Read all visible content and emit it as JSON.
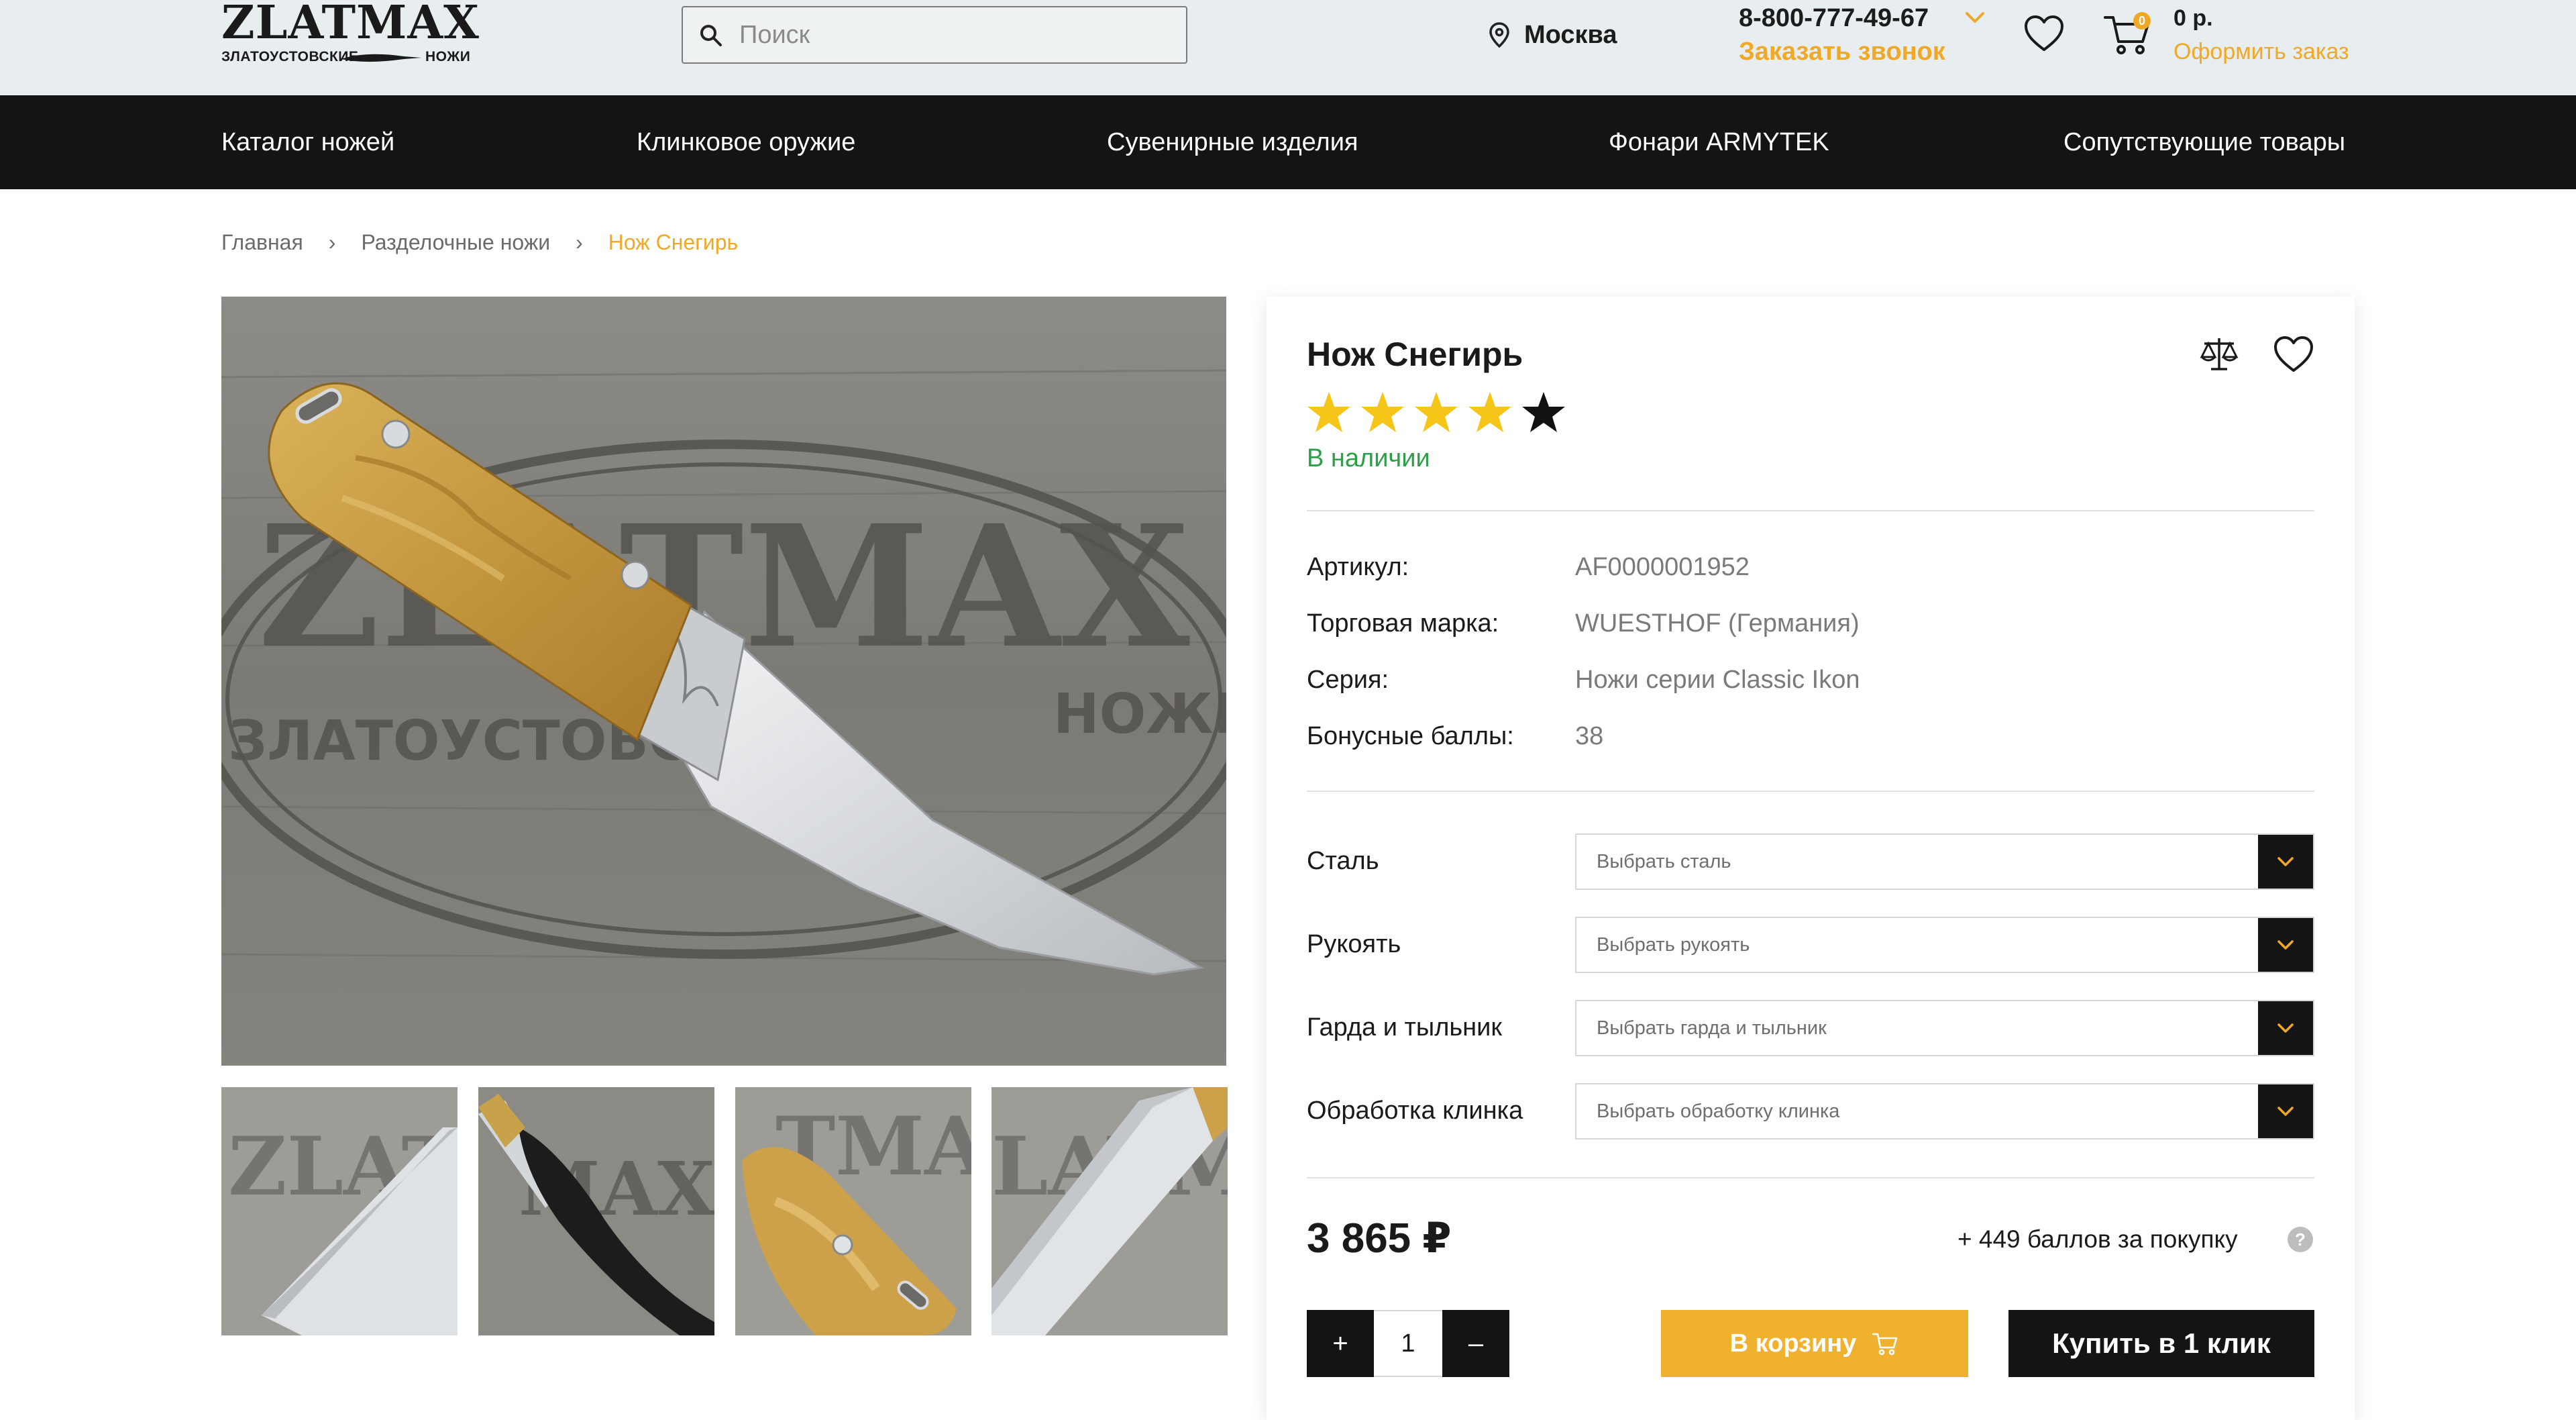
{
  "header": {
    "logo_main": "ZLATMAX",
    "logo_sub_left": "ЗЛАТОУСТОВСКИЕ",
    "logo_sub_right": "НОЖИ",
    "search_placeholder": "Поиск",
    "city": "Москва",
    "phone": "8-800-777-49-67",
    "callback_label": "Заказать звонок",
    "cart_count": "0",
    "cart_sum": "0 р.",
    "checkout_label": "Оформить заказ"
  },
  "nav": {
    "items": [
      {
        "label": "Каталог ножей"
      },
      {
        "label": "Клинковое оружие"
      },
      {
        "label": "Сувенирные изделия"
      },
      {
        "label": "Фонари ARMYTEK"
      },
      {
        "label": "Сопутствующие товары"
      }
    ]
  },
  "breadcrumb": {
    "items": [
      "Главная",
      "Разделочные ножи",
      "Нож Снегирь"
    ],
    "separator": "›"
  },
  "gallery": {
    "main_image_label": "ZLATMAX",
    "main_image_sub_left": "ЗЛАТОУСТОВСКИЕ",
    "main_image_sub_right": "НОЖИ",
    "thumbnails": [
      {
        "name": "blade-closeup"
      },
      {
        "name": "knife-in-sheath"
      },
      {
        "name": "handle-closeup"
      },
      {
        "name": "blade-marking"
      }
    ]
  },
  "product": {
    "title": "Нож Снегирь",
    "rating": 4,
    "rating_max": 5,
    "availability": "В наличии",
    "specs": [
      {
        "label": "Артикул:",
        "value": "AF0000001952"
      },
      {
        "label": "Торговая марка:",
        "value": "WUESTHOF (Германия)"
      },
      {
        "label": "Серия:",
        "value": "Ножи серии Classic Ikon"
      },
      {
        "label": "Бонусные баллы:",
        "value": "38"
      }
    ],
    "options": [
      {
        "label": "Сталь",
        "placeholder": "Выбрать сталь"
      },
      {
        "label": "Рукоять",
        "placeholder": "Выбрать рукоять"
      },
      {
        "label": "Гарда и тыльник",
        "placeholder": "Выбрать гарда и тыльник"
      },
      {
        "label": "Обработка клинка",
        "placeholder": "Выбрать обработку клинка"
      }
    ],
    "price": "3 865 ₽",
    "bonus_text": "+ 449 баллов за покупку",
    "help_symbol": "?",
    "quantity": "1",
    "qty_plus": "+",
    "qty_minus": "–",
    "add_to_cart_label": "В корзину",
    "buy_one_click_label": "Купить в 1 клик"
  },
  "colors": {
    "accent": "#f0a825",
    "nav_bg": "#141414",
    "header_bg": "#e8eef0",
    "in_stock": "#2e9e4a",
    "star_filled": "#f5c518",
    "star_empty": "#111111"
  },
  "icons": {
    "search": "search-icon",
    "location": "location-pin-icon",
    "chevron": "chevron-down-icon",
    "favorite": "heart-icon",
    "cart": "cart-icon",
    "compare": "scales-icon",
    "help": "question-icon"
  }
}
